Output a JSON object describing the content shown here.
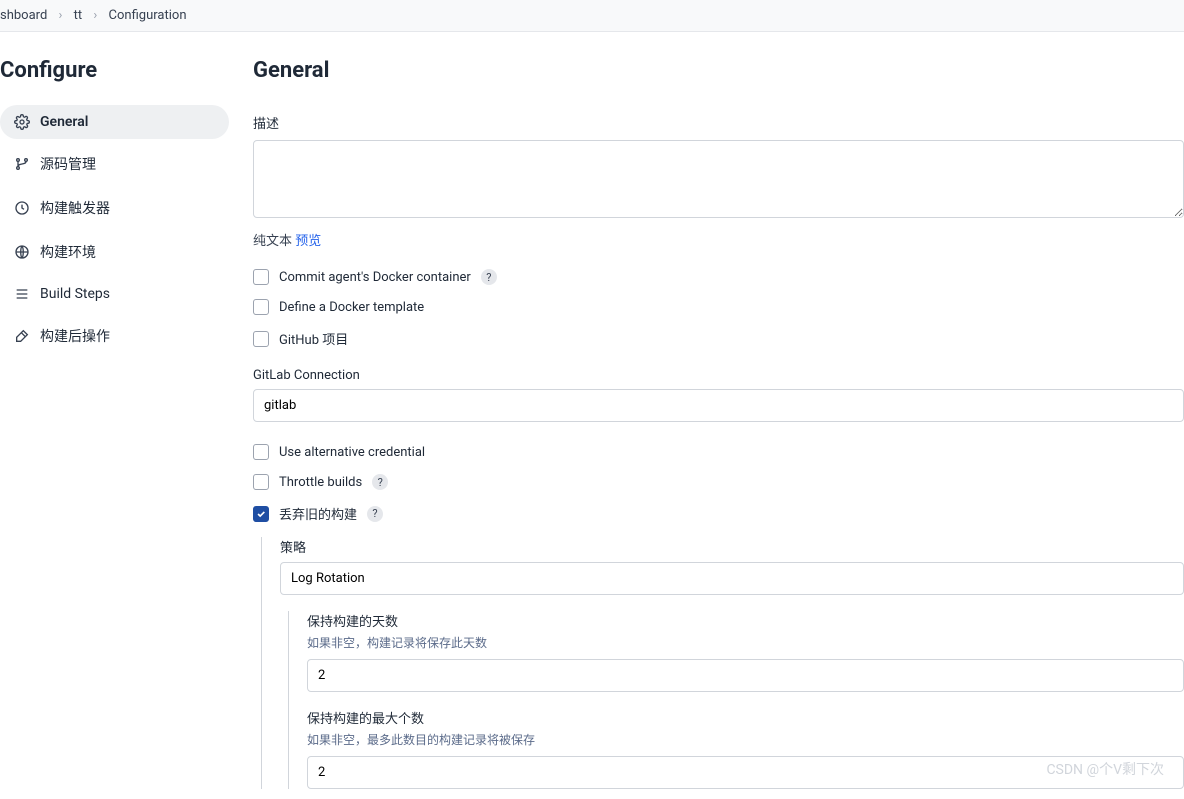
{
  "breadcrumb": {
    "items": [
      "shboard",
      "tt",
      "Configuration"
    ]
  },
  "sidebar": {
    "title": "Configure",
    "items": [
      {
        "label": "General",
        "active": true
      },
      {
        "label": "源码管理",
        "active": false
      },
      {
        "label": "构建触发器",
        "active": false
      },
      {
        "label": "构建环境",
        "active": false
      },
      {
        "label": "Build Steps",
        "active": false
      },
      {
        "label": "构建后操作",
        "active": false
      }
    ]
  },
  "content": {
    "title": "General",
    "descLabel": "描述",
    "plainText": "纯文本",
    "preview": "预览",
    "commitAgent": "Commit agent's Docker container",
    "defineTemplate": "Define a Docker template",
    "githubProject": "GitHub 项目",
    "gitlabConnLabel": "GitLab Connection",
    "gitlabConnValue": "gitlab",
    "altCred": "Use alternative credential",
    "throttle": "Throttle builds",
    "discardOld": "丢弃旧的构建",
    "strategy": "策略",
    "strategyValue": "Log Rotation",
    "keepDays": "保持构建的天数",
    "keepDaysDesc": "如果非空，构建记录将保存此天数",
    "keepDaysValue": "2",
    "keepMax": "保持构建的最大个数",
    "keepMaxDesc": "如果非空，最多此数目的构建记录将被保存",
    "keepMaxValue": "2"
  },
  "watermark": "CSDN @个V剩下次"
}
